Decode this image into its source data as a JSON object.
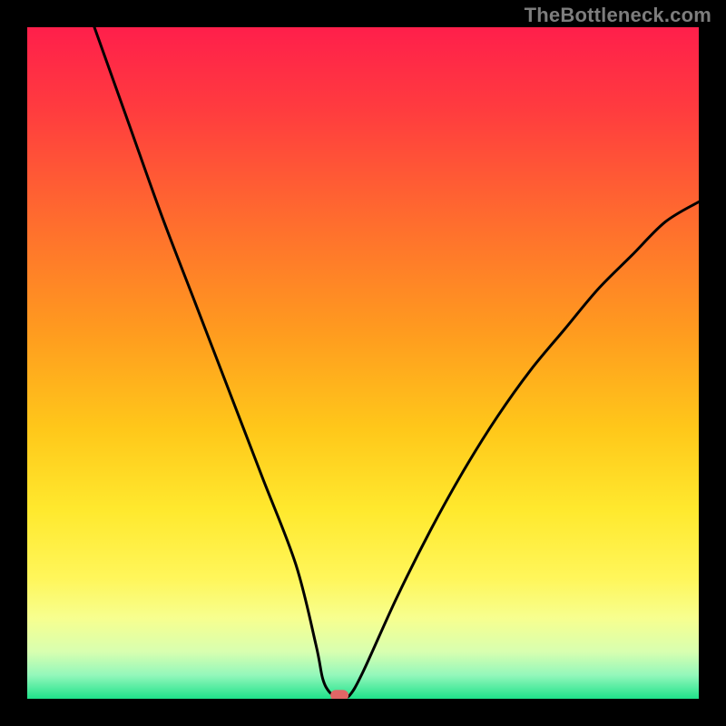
{
  "watermark": "TheBottleneck.com",
  "chart_data": {
    "type": "line",
    "title": "",
    "xlabel": "",
    "ylabel": "",
    "xlim": [
      0,
      100
    ],
    "ylim": [
      0,
      100
    ],
    "grid": false,
    "legend": false,
    "series": [
      {
        "name": "curve",
        "x": [
          10,
          15,
          20,
          25,
          30,
          35,
          40,
          43,
          44,
          45,
          46,
          47,
          48,
          50,
          55,
          60,
          65,
          70,
          75,
          80,
          85,
          90,
          95,
          100
        ],
        "y": [
          100,
          86,
          72,
          59,
          46,
          33,
          20,
          8,
          3,
          1,
          0.5,
          0.5,
          0.5,
          4,
          15,
          25,
          34,
          42,
          49,
          55,
          61,
          66,
          71,
          74
        ]
      }
    ],
    "marker": {
      "x": 46.5,
      "y": 0.5,
      "color": "#e06666"
    },
    "background_gradient": {
      "stops": [
        {
          "offset": 0.0,
          "color": "#ff1f4b"
        },
        {
          "offset": 0.12,
          "color": "#ff3b3f"
        },
        {
          "offset": 0.28,
          "color": "#ff6a2f"
        },
        {
          "offset": 0.45,
          "color": "#ff9a1f"
        },
        {
          "offset": 0.6,
          "color": "#ffc81a"
        },
        {
          "offset": 0.72,
          "color": "#ffe92e"
        },
        {
          "offset": 0.82,
          "color": "#fff65a"
        },
        {
          "offset": 0.88,
          "color": "#f7ff8f"
        },
        {
          "offset": 0.93,
          "color": "#d8ffb0"
        },
        {
          "offset": 0.965,
          "color": "#93f7bb"
        },
        {
          "offset": 1.0,
          "color": "#1fe28a"
        }
      ]
    }
  }
}
